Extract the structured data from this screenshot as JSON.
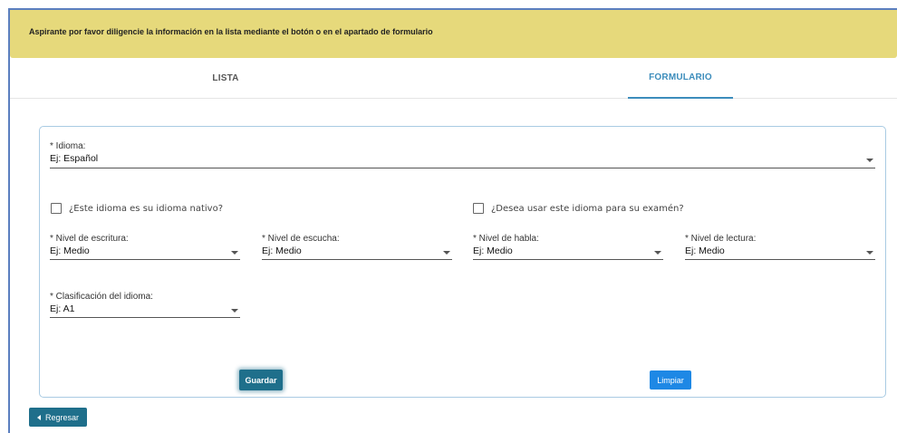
{
  "banner": {
    "message": "Aspirante por favor diligencie la información en la lista mediante el botón o en el apartado de formulario"
  },
  "tabs": [
    {
      "label": "LISTA",
      "active": false
    },
    {
      "label": "FORMULARIO",
      "active": true
    }
  ],
  "form": {
    "idioma": {
      "label": "* Idioma:",
      "value": "Ej: Español"
    },
    "nativo": {
      "label": "¿Este idioma es su idioma nativo?",
      "checked": false
    },
    "examen": {
      "label": "¿Desea usar este idioma para su examén?",
      "checked": false
    },
    "escritura": {
      "label": "* Nivel de escritura:",
      "value": "Ej: Medio"
    },
    "escucha": {
      "label": "* Nivel de escucha:",
      "value": "Ej: Medio"
    },
    "habla": {
      "label": "* Nivel de habla:",
      "value": "Ej: Medio"
    },
    "lectura": {
      "label": "* Nivel de lectura:",
      "value": "Ej: Medio"
    },
    "clasificacion": {
      "label": "* Clasificación del idioma:",
      "value": "Ej: A1"
    }
  },
  "buttons": {
    "guardar": "Guardar",
    "limpiar": "Limpiar",
    "regresar": "Regresar"
  },
  "colors": {
    "banner": "#e6d97b",
    "active_tab": "#3c8dbc",
    "primary_dark": "#1f6f8b",
    "primary_blue": "#1e88e5"
  },
  "icons": {
    "dropdown": "caret-down-icon",
    "back": "caret-left-icon"
  }
}
